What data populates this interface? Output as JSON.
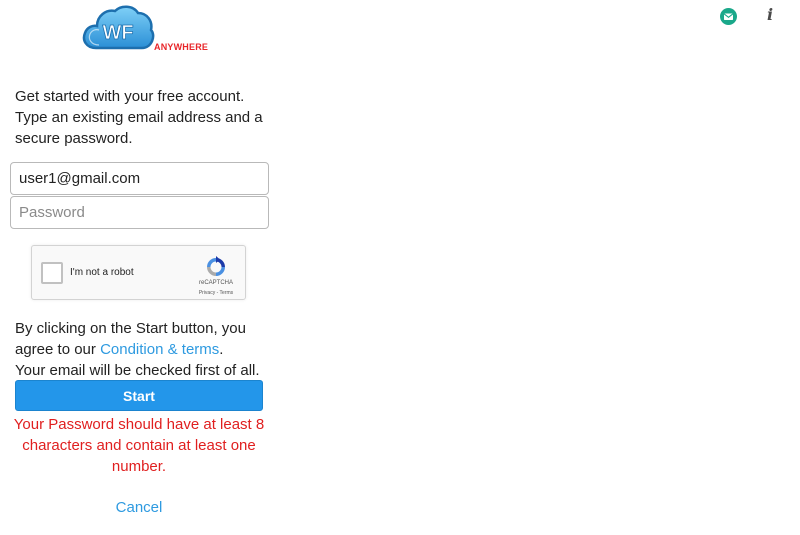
{
  "logo": {
    "initials": "WF",
    "tagline": "ANYWHERE"
  },
  "header": {
    "info_glyph": "i"
  },
  "intro": {
    "text": "Get started with your free account. Type an existing email address and a secure password."
  },
  "form": {
    "email_value": "user1@gmail.com",
    "password_placeholder": "Password",
    "password_value": ""
  },
  "recaptcha": {
    "label": "I'm not a robot",
    "brand": "reCAPTCHA",
    "links": "Privacy - Terms"
  },
  "terms": {
    "line1": "By clicking on the Start button, you agree to our ",
    "link": "Condition & terms",
    "line2": ".",
    "line3": "Your email will be checked first of all."
  },
  "start_label": "Start",
  "error": "Your Password should have at least 8 characters and contain at least one number.",
  "cancel_label": "Cancel",
  "colors": {
    "primary": "#2396ea",
    "link": "#2e9ae0",
    "error": "#e01f1f",
    "brand_red": "#e8262a",
    "mail_icon": "#1aa88a"
  },
  "icons": [
    "cloud-logo-icon",
    "mail-icon",
    "info-icon",
    "recaptcha-icon"
  ]
}
